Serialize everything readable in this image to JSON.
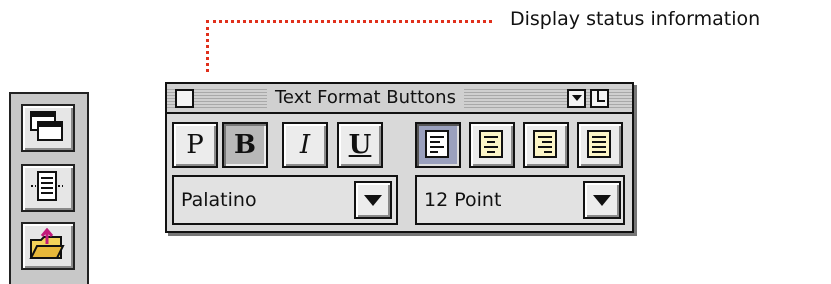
{
  "callout": {
    "text": "Display status information",
    "color": "#e0301c"
  },
  "left_toolbar": {
    "buttons": [
      {
        "icon": "windows-icon"
      },
      {
        "icon": "page-setup-icon"
      },
      {
        "icon": "folder-upload-icon"
      }
    ]
  },
  "palette": {
    "title": "Text Format Buttons",
    "style_buttons": [
      {
        "label": "P",
        "icon": "plain-text",
        "pressed": false
      },
      {
        "label": "B",
        "icon": "bold",
        "pressed": true
      },
      {
        "label": "I",
        "icon": "italic",
        "pressed": false
      },
      {
        "label": "U",
        "icon": "underline",
        "pressed": false
      }
    ],
    "align_buttons": [
      {
        "icon": "align-left-icon",
        "pressed": true
      },
      {
        "icon": "align-center-icon",
        "pressed": false
      },
      {
        "icon": "align-right-icon",
        "pressed": false
      },
      {
        "icon": "align-justify-icon",
        "pressed": false
      }
    ],
    "font_popup": {
      "value": "Palatino"
    },
    "size_popup": {
      "value": "12 Point"
    },
    "accent_pressed_color": "#9aa0bd"
  }
}
